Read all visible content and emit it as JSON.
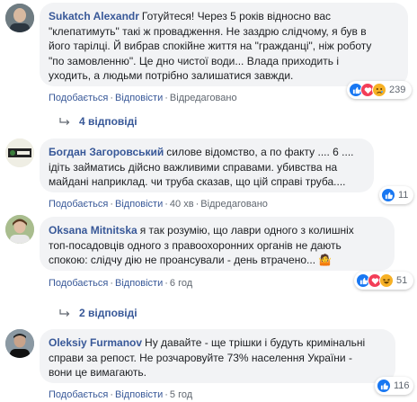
{
  "comments": [
    {
      "author": "Sukatch Alexandr",
      "text": "Готуйтеся! Через 5 років відносно вас\n\"клепатимуть\" такі ж провадження. Не заздрю слідчому, я був в\nйого тарілці. Й вибрав спокійне життя на \"гражданці\", ніж роботу\n\"по замовленню\". Це дно чистої води... Влада приходить і\nуходить, а людьми потрібно залишатися завжди.",
      "like": "Подобається",
      "reply": "Відповісти",
      "extra": "Відредаговано",
      "reaction_count": "239",
      "reactions": [
        "like-icon",
        "love-icon",
        "sad-icon"
      ]
    },
    {
      "author": "Богдан Загоровський",
      "text": "силове відомство, а по факту .... 6 ....\nідіть займатись дійсно важливими справами. убивства на\nмайдані наприклад. чи труба сказав, що цій справі труба....",
      "like": "Подобається",
      "reply": "Відповісти",
      "time": "40 хв",
      "extra": "Відредаговано",
      "reaction_count": "11",
      "reactions": [
        "like-icon"
      ]
    },
    {
      "author": "Oksana Mitnitska",
      "text": "я так розумію, що лаври одного з колишніх\nтоп-посадовців одного з правоохоронних органів не дають\nспокою: слідчу дію не проансували - день втрачено...",
      "like": "Подобається",
      "reply": "Відповісти",
      "time": "6 год",
      "reaction_count": "51",
      "reactions": [
        "like-icon",
        "love-icon",
        "haha-icon"
      ]
    },
    {
      "author": "Oleksiy Furmanov",
      "text": "Ну давайте - ще трішки і будуть кримінальні\nсправи за репост. Не розчаровуйте 73% населення України -\nвони це вимагають.",
      "like": "Подобається",
      "reply": "Відповісти",
      "time": "5 год",
      "reaction_count": "116",
      "reactions": [
        "like-icon"
      ]
    }
  ],
  "replies_links": [
    {
      "label": "4 відповіді"
    },
    {
      "label": "2 відповіді"
    }
  ],
  "colors": {
    "link": "#385898",
    "bubble": "#f2f3f5",
    "meta": "#606770",
    "like": "#1877f2",
    "love": "#f33e58",
    "haha": "#f7b125"
  }
}
